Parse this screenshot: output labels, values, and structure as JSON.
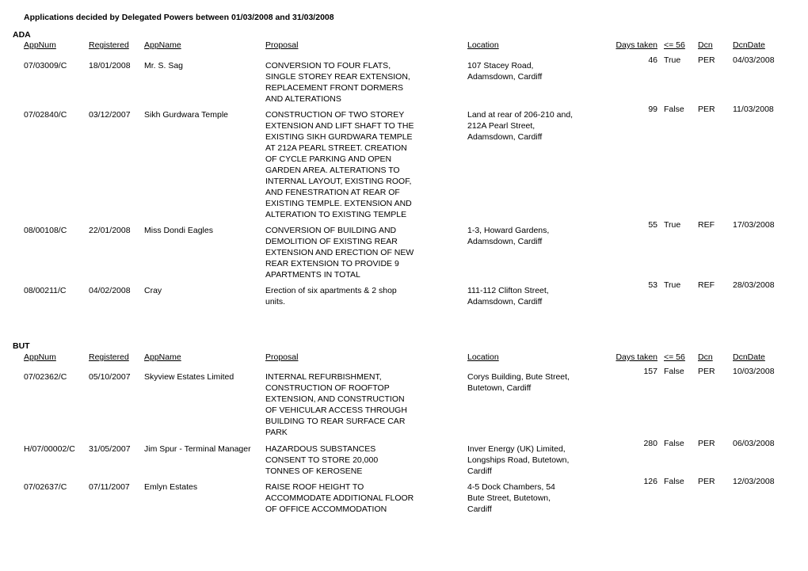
{
  "title": "Applications decided by Delegated Powers between 01/03/2008 and 31/03/2008",
  "columns": {
    "appnum": "AppNum",
    "registered": "Registered",
    "appname": "AppName",
    "proposal": "Proposal",
    "location": "Location",
    "days_taken": "Days taken",
    "le56": "<= 56",
    "dcn": "Dcn",
    "dcndate": "DcnDate"
  },
  "sections": [
    {
      "name": "ADA",
      "rows": [
        {
          "appnum": "07/03009/C",
          "registered": "18/01/2008",
          "appname": "Mr. S. Sag",
          "proposal": [
            "CONVERSION TO FOUR FLATS,",
            "SINGLE STOREY REAR EXTENSION,",
            "REPLACEMENT FRONT DORMERS",
            "AND ALTERATIONS"
          ],
          "location": [
            "107 Stacey Road,",
            "Adamsdown, Cardiff"
          ],
          "days_taken": "46",
          "le56": "True",
          "dcn": "PER",
          "dcndate": "04/03/2008"
        },
        {
          "appnum": "07/02840/C",
          "registered": "03/12/2007",
          "appname": "Sikh Gurdwara Temple",
          "proposal": [
            "CONSTRUCTION OF TWO STOREY",
            "EXTENSION AND LIFT SHAFT TO THE",
            "EXISTING SIKH GURDWARA TEMPLE",
            "AT 212A PEARL STREET.  CREATION",
            "OF CYCLE PARKING AND OPEN",
            "GARDEN AREA.  ALTERATIONS TO",
            "INTERNAL LAYOUT, EXISTING ROOF,",
            "AND FENESTRATION AT REAR OF",
            "EXISTING TEMPLE.  EXTENSION AND",
            "ALTERATION TO EXISTING TEMPLE"
          ],
          "location": [
            "Land at rear of 206-210 and,",
            "212A Pearl Street,",
            "Adamsdown, Cardiff"
          ],
          "days_taken": "99",
          "le56": "False",
          "dcn": "PER",
          "dcndate": "11/03/2008"
        },
        {
          "appnum": "08/00108/C",
          "registered": "22/01/2008",
          "appname": "Miss Dondi Eagles",
          "proposal": [
            "CONVERSION OF BUILDING AND",
            "DEMOLITION OF EXISTING REAR",
            "EXTENSION AND ERECTION OF NEW",
            "REAR EXTENSION TO PROVIDE 9",
            "APARTMENTS IN TOTAL"
          ],
          "location": [
            "1-3, Howard Gardens,",
            "Adamsdown, Cardiff"
          ],
          "days_taken": "55",
          "le56": "True",
          "dcn": "REF",
          "dcndate": "17/03/2008"
        },
        {
          "appnum": "08/00211/C",
          "registered": "04/02/2008",
          "appname": "Cray",
          "proposal": [
            "Erection of six apartments & 2 shop",
            "units."
          ],
          "location": [
            "111-112 Clifton Street,",
            "Adamsdown, Cardiff"
          ],
          "days_taken": "53",
          "le56": "True",
          "dcn": "REF",
          "dcndate": "28/03/2008"
        }
      ]
    },
    {
      "name": "BUT",
      "rows": [
        {
          "appnum": "07/02362/C",
          "registered": "05/10/2007",
          "appname": "Skyview Estates Limited",
          "proposal": [
            "INTERNAL REFURBISHMENT,",
            "CONSTRUCTION OF ROOFTOP",
            "EXTENSION, AND CONSTRUCTION",
            "OF VEHICULAR ACCESS THROUGH",
            "BUILDING TO REAR SURFACE CAR",
            "PARK"
          ],
          "location": [
            "Corys Building, Bute Street,",
            "Butetown, Cardiff"
          ],
          "days_taken": "157",
          "le56": "False",
          "dcn": "PER",
          "dcndate": "10/03/2008"
        },
        {
          "appnum": "H/07/00002/C",
          "registered": "31/05/2007",
          "appname": "Jim Spur - Terminal Manager",
          "proposal": [
            "HAZARDOUS SUBSTANCES",
            "CONSENT TO STORE 20,000",
            "TONNES OF KEROSENE"
          ],
          "location": [
            "Inver Energy (UK) Limited,",
            "Longships Road, Butetown,",
            "Cardiff"
          ],
          "days_taken": "280",
          "le56": "False",
          "dcn": "PER",
          "dcndate": "06/03/2008"
        },
        {
          "appnum": "07/02637/C",
          "registered": "07/11/2007",
          "appname": "Emlyn Estates",
          "proposal": [
            "RAISE ROOF HEIGHT TO",
            "ACCOMMODATE ADDITIONAL FLOOR",
            "OF OFFICE ACCOMMODATION"
          ],
          "location": [
            "4-5 Dock Chambers, 54",
            "Bute Street, Butetown,",
            "Cardiff"
          ],
          "days_taken": "126",
          "le56": "False",
          "dcn": "PER",
          "dcndate": "12/03/2008"
        }
      ]
    }
  ]
}
